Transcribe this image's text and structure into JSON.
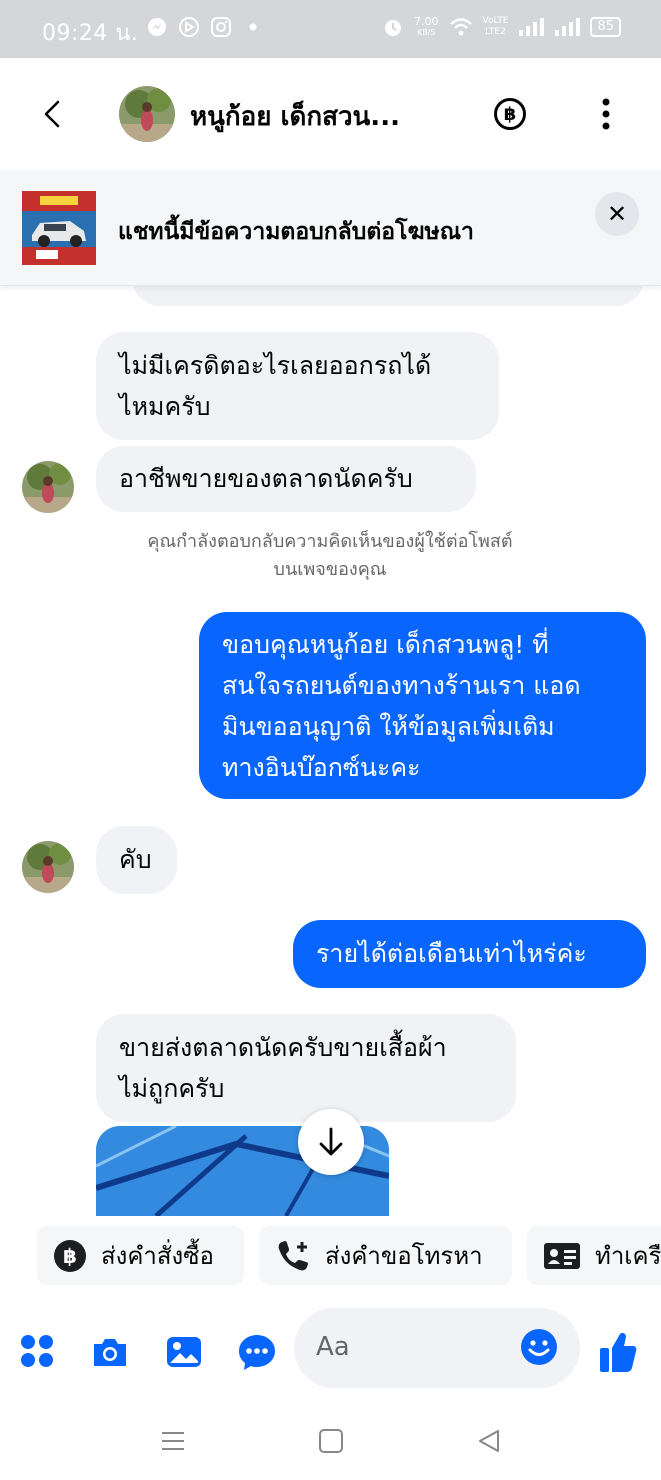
{
  "status_bar": {
    "time": "09:24 น.",
    "net_speed_value": "7.00",
    "net_speed_unit": "KB/S",
    "network_tech_top": "VoLTE",
    "network_tech_bottom": "LTE2",
    "battery": "85",
    "icons": [
      "messenger-icon",
      "unknown-app-icon",
      "instagram-icon",
      "dot-icon",
      "alarm-icon",
      "wifi-icon",
      "signal-icon",
      "signal-icon",
      "battery-icon"
    ]
  },
  "header": {
    "contact_name": "หนูก้อย เด็กสวน...",
    "baht_symbol": "฿",
    "icons": [
      "back-arrow-icon",
      "contact-avatar",
      "baht-circle-icon",
      "more-vertical-icon"
    ]
  },
  "ad_banner": {
    "text": "แชทนี้มีข้อความตอบกลับต่อโฆษณา",
    "close_symbol": "✕"
  },
  "messages": [
    {
      "from": "them",
      "text_lines": [
        "ไม่มีเครดิตอะไรเลยออกรถได้",
        "ไหมครับ"
      ]
    },
    {
      "from": "them",
      "text_lines": [
        "อาชีพขายของตลาดนัดครับ"
      ]
    },
    {
      "from": "system",
      "text_lines": [
        "คุณกำลังตอบกลับความคิดเห็นของผู้ใช้ต่อโพสต์",
        "บนเพจของคุณ"
      ]
    },
    {
      "from": "me",
      "text_lines": [
        "ขอบคุณหนูก้อย เด็กสวนพลู! ที่",
        "สนใจรถยนต์ของทางร้านเรา แอด",
        "มินขออนุญาติ ให้ข้อมูลเพิ่มเติม",
        "ทางอินบ๊อกซ์นะคะ"
      ]
    },
    {
      "from": "them",
      "text_lines": [
        "คับ"
      ]
    },
    {
      "from": "me",
      "text_lines": [
        "รายได้ต่อเดือนเท่าไหร่ค่ะ"
      ]
    },
    {
      "from": "them",
      "text_lines": [
        "ขายส่งตลาดนัดครับขายเสื้อผ้า",
        "ไม่ถูกครับ"
      ]
    }
  ],
  "quick_replies": [
    {
      "label": "ส่งคำสั่งซื้อ",
      "icon": "baht-circle-icon"
    },
    {
      "label": "ส่งคำขอโทรหา",
      "icon": "phone-plus-icon"
    },
    {
      "label": "ทำเครื",
      "icon": "contact-card-icon"
    }
  ],
  "composer": {
    "placeholder": "Aa",
    "icons": [
      "apps-grid-icon",
      "camera-icon",
      "gallery-icon",
      "chat-bubble-icon",
      "emoji-icon",
      "thumbs-up-icon"
    ]
  },
  "navbar": {
    "icons": [
      "menu-lines-icon",
      "home-square-icon",
      "back-triangle-icon"
    ]
  },
  "colors": {
    "brand_blue": "#0866ff",
    "incoming_bubble": "#f0f2f5",
    "status_bar": "#d4d6d9"
  }
}
